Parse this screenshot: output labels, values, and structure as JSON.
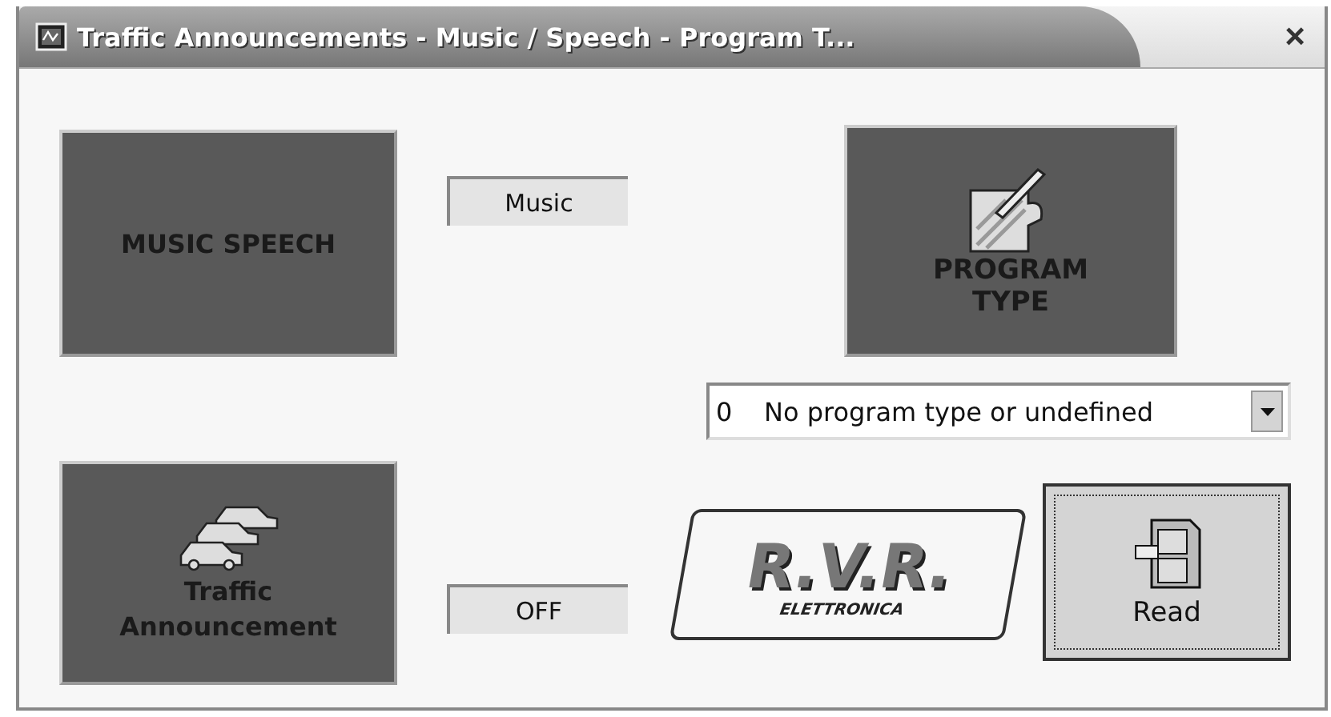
{
  "window": {
    "title": "Traffic Announcements - Music / Speech - Program T...",
    "close": "×"
  },
  "music_speech": {
    "button": "MUSIC SPEECH",
    "indicator": "Music"
  },
  "program_type": {
    "button_lines": [
      "PROGRAM",
      "TYPE"
    ],
    "dropdown": {
      "code": "0",
      "value": "No program type or undefined"
    }
  },
  "traffic": {
    "button_lines": [
      "Traffic",
      "Announcement"
    ],
    "indicator": "OFF"
  },
  "logo": {
    "letters": "R.V.R.",
    "subtitle": "ELETTRONICA"
  },
  "read_button": "Read"
}
